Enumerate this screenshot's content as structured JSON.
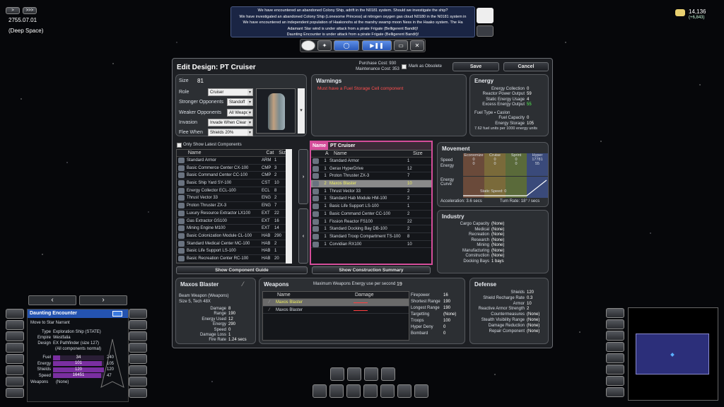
{
  "top_left": {
    "date": "2755.07.01",
    "location": "(Deep Space)",
    "btn_prev": ">",
    "btn_next": ">>>"
  },
  "top_right": {
    "credits": "14,136",
    "credits_delta": "(+6,843)"
  },
  "messages": [
    "We have encountered an abandoned Colony Ship, adrift in the N0181 system. Should we investigate the ship?",
    "We have investigated an abandoned Colony Ship (Lonesome Princess) at nitrogen oxygen gas cloud N0180 in the N0181 system in",
    "We have encountered an independent population of Haakonohs at the marshy swamp moon Ness in the Haako system. The Ha",
    "Adamant Star wind is under attack from a pirate Frigate (Belligerent Bandit)!",
    "Daunting Encounter is under attack from a pirate Frigate (Belligerent Bandit)!"
  ],
  "editor": {
    "title": "Edit Design: PT Cruiser",
    "purchase_cost": "Purchase Cost: 930",
    "maintenance_cost": "Maintenance Cost: 353",
    "obsolete_label": "Mark as Obsolete",
    "save": "Save",
    "cancel": "Cancel",
    "size_label": "Size",
    "size_value": "81",
    "role_label": "Role",
    "role_value": "Cruiser",
    "stronger_label": "Stronger Opponents",
    "stronger_value": "Standoff",
    "weaker_label": "Weaker Opponents",
    "weaker_value": "All Weapo",
    "invasion_label": "Invasion",
    "invasion_value": "Invade When Clear",
    "flee_label": "Flee When",
    "flee_value": "Shields 20%",
    "warnings_title": "Warnings",
    "warning_text": "Must have a Fuel Storage Cell component",
    "energy": {
      "title": "Energy",
      "collection_l": "Energy Collection",
      "collection_v": "0",
      "reactor_l": "Reactor Power Output",
      "reactor_v": "59",
      "static_l": "Static Energy Usage",
      "static_v": "4",
      "excess_l": "Excess Energy Output",
      "excess_v": "55",
      "fuel_type": "Fuel Type ▪ Caslon",
      "fuel_cap_l": "Fuel Capacity",
      "fuel_cap_v": "0",
      "storage_l": "Energy Storage",
      "storage_v": "105",
      "fuel_note": "7.62 fuel units per 1000 energy units"
    },
    "only_latest": "Only Show Latest Components",
    "comp_headers": [
      "Name",
      "Cat",
      "Size"
    ],
    "components": [
      [
        "Standard Armor",
        "ARM",
        "1"
      ],
      [
        "Basic Commerce Center CX-100",
        "CMP",
        "3"
      ],
      [
        "Basic Command Center CC-100",
        "CMP",
        "2"
      ],
      [
        "Basic Ship Yard SY-100",
        "CST",
        "10"
      ],
      [
        "Energy Collector ECL-100",
        "ECL",
        "8"
      ],
      [
        "Thrust Vector 33",
        "ENG",
        "2"
      ],
      [
        "Proton Thruster ZX-3",
        "ENG",
        "7"
      ],
      [
        "Luxury Resource Extractor LX100",
        "EXT",
        "22"
      ],
      [
        "Gas Extractor GS100",
        "EXT",
        "16"
      ],
      [
        "Mining Engine M100",
        "EXT",
        "14"
      ],
      [
        "Basic Colonization Module CL-100",
        "HAB",
        "290"
      ],
      [
        "Standard Medical Center MC-100",
        "HAB",
        "2"
      ],
      [
        "Basic Life Support LS-100",
        "HAB",
        "1"
      ],
      [
        "Basic Recreation Center RC-100",
        "HAB",
        "20"
      ]
    ],
    "show_guide": "Show Component Guide",
    "design_name_label": "Name",
    "design_name_value": "PT Cruiser",
    "design_headers": [
      "A",
      "Name",
      "Size"
    ],
    "design_components": [
      [
        "1",
        "Standard Armor",
        "1"
      ],
      [
        "1",
        "Gerax HyperDrive",
        "12"
      ],
      [
        "1",
        "Proton Thruster ZX-3",
        "7"
      ],
      [
        "2",
        "Maxos Blaster",
        "10"
      ],
      [
        "1",
        "Thrust Vector 33",
        "2"
      ],
      [
        "1",
        "Standard Hab Module HM-100",
        "2"
      ],
      [
        "1",
        "Basic Life Support LS-100",
        "1"
      ],
      [
        "1",
        "Basic Command Center CC-100",
        "2"
      ],
      [
        "1",
        "Fission Reactor FS100",
        "22"
      ],
      [
        "1",
        "Standard Docking Bay DB-100",
        "2"
      ],
      [
        "1",
        "Standard Troop Compartment TS-100",
        "8"
      ],
      [
        "1",
        "Corvidian RX100",
        "10"
      ]
    ],
    "show_summary": "Show Construction Summary",
    "movement": {
      "title": "Movement",
      "cols": [
        "Economize",
        "Cruise",
        "Sprint",
        "Hyper"
      ],
      "speed_l": "Speed",
      "speed_v": [
        "0",
        "0",
        "0",
        "17781"
      ],
      "energy_l": "Energy",
      "energy_v": [
        "0",
        "0",
        "0",
        "55"
      ],
      "curve_l": "Energy Curve",
      "accel": "Acceleration: 3.6 secs",
      "static": "Static Speed: 0",
      "turn": "Turn Rate: 18° / secs"
    },
    "industry": {
      "title": "Industry",
      "rows": [
        [
          "Cargo Capacity",
          "(None)"
        ],
        [
          "Medical",
          "(None)"
        ],
        [
          "Recreation",
          "(None)"
        ],
        [
          "Research",
          "(None)"
        ],
        [
          "Mining",
          "(None)"
        ],
        [
          "Manufacturing",
          "(None)"
        ],
        [
          "Construction",
          "(None)"
        ],
        [
          "Docking Bays",
          "1 bays"
        ]
      ]
    },
    "weapon_detail": {
      "title": "Maxos Blaster",
      "type": "Beam Weapon (Weapons)",
      "size": "Size 5, Tech 48X",
      "rows": [
        [
          "Damage",
          "8"
        ],
        [
          "Range",
          "190"
        ],
        [
          "Energy Used",
          "12"
        ],
        [
          "Energy",
          "290"
        ],
        [
          "Speed",
          "0"
        ],
        [
          "Damage Loss",
          "1"
        ],
        [
          "Fire Rate",
          "1.24 secs"
        ]
      ]
    },
    "weapons": {
      "title": "Weapons",
      "max_label": "Maximum Weapons Energy use per second",
      "max_value": "19",
      "headers": [
        "Name",
        "Damage"
      ],
      "rows": [
        "Maxos Blaster",
        "Maxos Blaster"
      ],
      "stats": [
        [
          "Firepower",
          "16"
        ],
        [
          "Shortest Range",
          "190"
        ],
        [
          "Longest Range",
          "190"
        ],
        [
          "Targetting",
          "(None)"
        ],
        [
          "Troops",
          "100"
        ],
        [
          "Hyper Deny",
          "0"
        ],
        [
          "Bombard",
          "0"
        ]
      ]
    },
    "defense": {
      "title": "Defense",
      "rows": [
        [
          "Shields",
          "120"
        ],
        [
          "Shield Recharge Rate",
          "0.3"
        ],
        [
          "Armor",
          "10"
        ],
        [
          "Reactive Armor Strength",
          "2"
        ],
        [
          "Countermeasures",
          "(None)"
        ],
        [
          "Stealth Visibility Range",
          "(None)"
        ],
        [
          "Damage Reduction",
          "(None)"
        ],
        [
          "Repair Component",
          "(None)"
        ]
      ]
    }
  },
  "ship": {
    "name": "Daunting Encounter",
    "mission": "Move to Star Narrant",
    "type_l": "Type",
    "type_v": "Exploration Ship (STATE)",
    "empire_l": "Empire",
    "empire_v": "Westfalia",
    "design_l": "Design",
    "design_v": "EX Pathfinder (size 127)",
    "design_note": "(All components normal)",
    "fuel_l": "Fuel",
    "fuel_v": "34",
    "fuel_max": "240",
    "energy_l": "Energy",
    "energy_v": "101",
    "energy_max": "105",
    "shields_l": "Shields",
    "shields_v": "120",
    "shields_max": "120",
    "speed_l": "Speed",
    "speed_v": "16451",
    "speed_max": "47",
    "weapons_l": "Weapons",
    "weapons_v": "(None)",
    "fuel_pct": 0.14,
    "energy_pct": 0.96,
    "shields_pct": 1.0,
    "speed_pct": 0.95
  },
  "colors": {
    "accent": "#3a6fd4",
    "warning": "#ff4d4d",
    "design_border": "#d44d9a",
    "highlight": "#e0e070"
  }
}
